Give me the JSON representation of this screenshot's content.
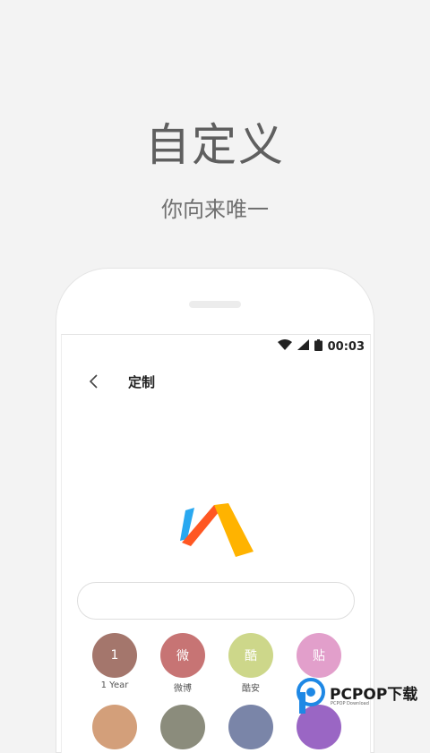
{
  "intro": {
    "title": "自定义",
    "subtitle": "你向来唯一"
  },
  "status_bar": {
    "time": "00:03",
    "icons": [
      "wifi-icon",
      "signal-icon",
      "battery-icon"
    ]
  },
  "app_bar": {
    "title": "定制",
    "back_icon": "chevron-left-icon"
  },
  "logo": {
    "name": "via-browser-logo",
    "colors": [
      "#29a8f0",
      "#ff5722",
      "#ffb300"
    ]
  },
  "search": {
    "value": "",
    "placeholder": ""
  },
  "shortcuts": [
    {
      "glyph": "1",
      "label": "1 Year",
      "color": "#a4766c"
    },
    {
      "glyph": "微",
      "label": "微博",
      "color": "#c77474"
    },
    {
      "glyph": "酷",
      "label": "酷安",
      "color": "#cdd78a"
    },
    {
      "glyph": "贴",
      "label": "",
      "color": "#e29fcb"
    },
    {
      "glyph": "",
      "label": "",
      "color": "#d39f7a"
    },
    {
      "glyph": "",
      "label": "",
      "color": "#8b8c7c"
    },
    {
      "glyph": "",
      "label": "",
      "color": "#7a85a8"
    },
    {
      "glyph": "",
      "label": "",
      "color": "#9a66c4"
    }
  ],
  "watermark": {
    "text": "PCPOP下载",
    "subtext": "PCPOP Download",
    "color": "#1e88e5"
  }
}
